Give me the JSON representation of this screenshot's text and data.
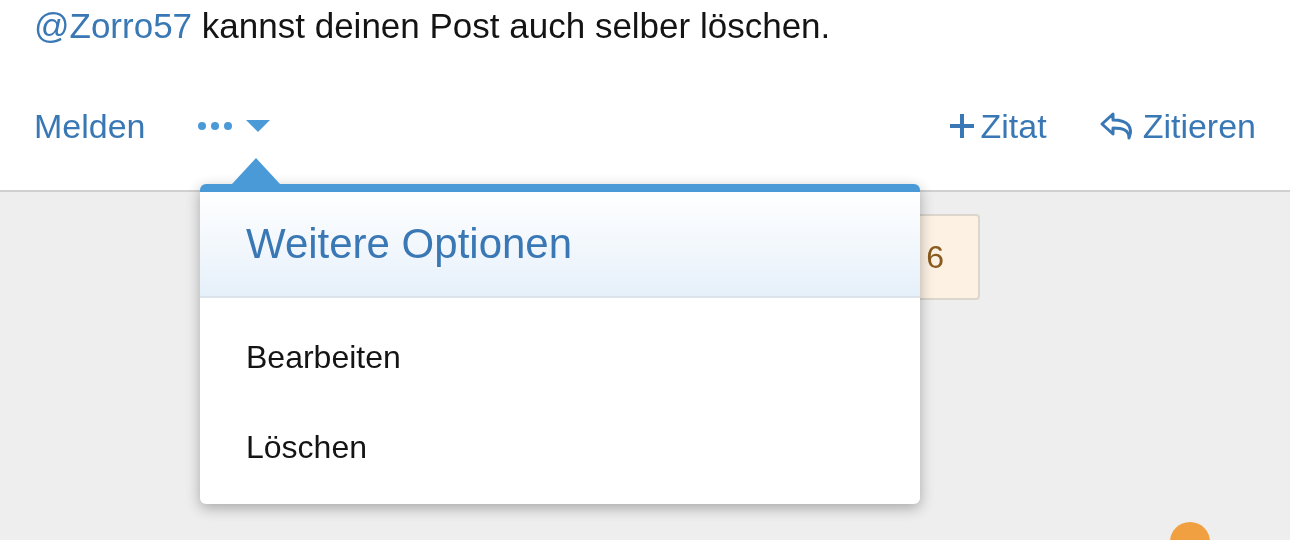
{
  "post": {
    "mention": "@Zorro57",
    "text": "kannst deinen Post auch selber löschen."
  },
  "actions": {
    "left": [
      {
        "kind": "link",
        "label": "Melden"
      },
      {
        "kind": "more",
        "expanded": true
      }
    ],
    "right": [
      {
        "kind": "multiquote",
        "label": "Zitat"
      },
      {
        "kind": "reply",
        "label": "Zitieren"
      }
    ]
  },
  "badge": {
    "text": "6"
  },
  "menu": {
    "title": "Weitere Optionen",
    "items": [
      {
        "label": "Bearbeiten"
      },
      {
        "label": "Löschen"
      }
    ]
  }
}
